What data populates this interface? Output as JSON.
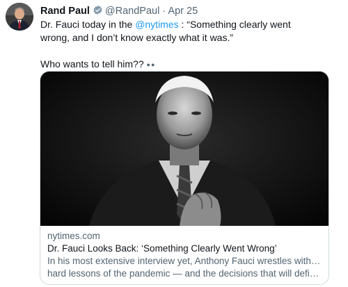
{
  "author": {
    "display_name": "Rand Paul",
    "handle": "@RandPaul",
    "separator": "·",
    "date": "Apr 25",
    "verified": true,
    "avatar_icon": "profile-photo"
  },
  "tweet": {
    "line1_prefix": "Dr. Fauci today in the ",
    "mention": "@nytimes",
    "line1_suffix": " : “Something clearly went wrong, and I don’t know exactly what it was.”",
    "line2": "Who wants to tell him??",
    "emoji": "eyes-emoji"
  },
  "card": {
    "image_icon": "fauci-portrait",
    "domain": "nytimes.com",
    "headline": "Dr. Fauci Looks Back: ‘Something Clearly Went Wrong’",
    "summary_line1": "In his most extensive interview yet, Anthony Fauci wrestles with the",
    "summary_line2": "hard lessons of the pandemic — and the decisions that will define hi..."
  },
  "colors": {
    "accent": "#1d9bf0",
    "secondary_text": "#536471",
    "border": "#cfd9de"
  }
}
